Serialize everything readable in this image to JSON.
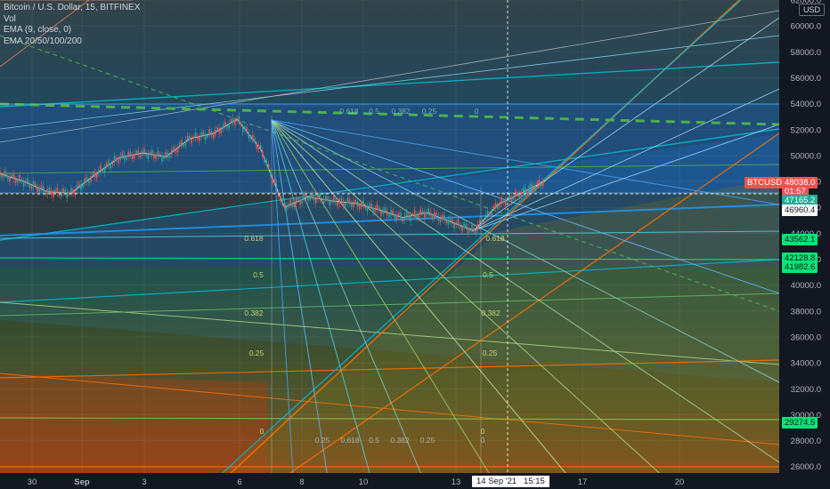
{
  "legend": {
    "symbol": "Bitcoin / U.S. Dollar, 15, BITFINEX",
    "vol": "Vol",
    "ema9": "EMA (9, close, 0)",
    "ema_multi": "EMA 20/50/100/200"
  },
  "currency_button": "USD",
  "price_tags": {
    "symbol": {
      "text": "BTCUSD",
      "bg": "#ef5350",
      "fg": "#ffffff"
    },
    "last": {
      "text": "48038.0",
      "bg": "#ef5350",
      "fg": "#ffffff"
    },
    "countdown": {
      "text": "01:57",
      "bg": "#ef5350",
      "fg": "#ffffff"
    },
    "cursor": {
      "text": "46960.4",
      "bg": "#ffffff",
      "fg": "#131722"
    },
    "level_47165": {
      "text": "47165.2",
      "bg": "#22ab94",
      "fg": "#ffffff"
    },
    "level_43562": {
      "text": "43562.1",
      "bg": "#00e676",
      "fg": "#131722"
    },
    "level_42128": {
      "text": "42128.8",
      "bg": "#00e676",
      "fg": "#131722"
    },
    "level_41982": {
      "text": "41982.6",
      "bg": "#00e676",
      "fg": "#131722"
    },
    "level_29274": {
      "text": "29274.5",
      "bg": "#00e676",
      "fg": "#131722"
    }
  },
  "time_cursor_label": "14 Sep '21   15:15",
  "fib_labels": {
    "top_row": [
      "0.618",
      "0.5",
      "0.382",
      "0.25",
      "0"
    ],
    "left_col": [
      "0.618",
      "0.5",
      "0.382",
      "0.25",
      "0"
    ],
    "right_col": [
      "0.618",
      "0.5",
      "0.382",
      "0.25",
      "0"
    ],
    "bottom_row": [
      "0.25",
      "0.618",
      "0.5",
      "0.382",
      "0.25",
      "0"
    ]
  },
  "colors": {
    "background": "#131722",
    "axis_text": "#b2b5be",
    "candle_up": "#26a69a",
    "candle_down": "#ef5350",
    "ema_green_dash": "#4caf50",
    "fan_blue": "#2196f3",
    "fan_cyan": "#00bcd4",
    "fan_orange": "#ff6d00",
    "level_green": "#00e676"
  },
  "chart_data": {
    "type": "line",
    "title": "Bitcoin / U.S. Dollar, 15, BITFINEX",
    "xlabel": "",
    "ylabel": "",
    "ylim": [
      25500,
      62000
    ],
    "x_axis_ticks": [
      "30",
      "Sep",
      "3",
      "6",
      "8",
      "10",
      "13",
      "17",
      "20"
    ],
    "y_axis_ticks": [
      "62000.0",
      "60000.0",
      "58000.0",
      "56000.0",
      "54000.0",
      "52000.0",
      "50000.0",
      "48000.0",
      "46000.0",
      "44000.0",
      "42000.0",
      "40000.0",
      "38000.0",
      "36000.0",
      "34000.0",
      "32000.0",
      "30000.0",
      "28000.0",
      "26000.0"
    ],
    "grid": true,
    "series": [
      {
        "name": "BTCUSD",
        "x": [
          "Aug 29",
          "Aug 30",
          "Aug 31",
          "Sep 1",
          "Sep 2",
          "Sep 3",
          "Sep 4",
          "Sep 5",
          "Sep 6",
          "Sep 6 12h",
          "Sep 7 00h",
          "Sep 7 06h",
          "Sep 7 12h",
          "Sep 7 18h",
          "Sep 8",
          "Sep 9",
          "Sep 10",
          "Sep 11",
          "Sep 12",
          "Sep 13",
          "Sep 13 12h",
          "Sep 14",
          "Sep 14 12h",
          "Sep 14 18h"
        ],
        "values": [
          48600,
          48000,
          47200,
          47100,
          48500,
          49800,
          50200,
          49900,
          51300,
          51700,
          52800,
          50500,
          46000,
          46800,
          46500,
          46300,
          45800,
          45200,
          45600,
          44900,
          44200,
          46200,
          47100,
          48038
        ]
      }
    ],
    "price_levels": [
      47165.2,
      46960.4,
      43562.1,
      42128.8,
      41982.6,
      29274.5
    ],
    "last_price": 48038.0
  }
}
